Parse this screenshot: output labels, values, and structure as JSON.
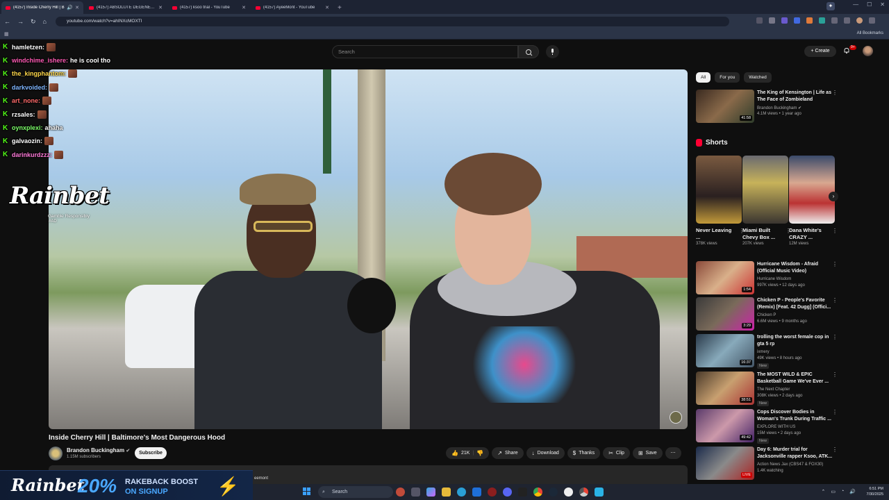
{
  "browser": {
    "tabs": [
      {
        "title": "(4157) Inside Cherry Hill | B",
        "active": true
      },
      {
        "title": "(4157) ABSOLUTE DEGENERATE",
        "active": false
      },
      {
        "title": "(4157) ksoo trial - YouTube",
        "active": false
      },
      {
        "title": "(4157) AyeeMont - YouTube",
        "active": false
      }
    ],
    "url": "youtube.com/watch?v=ahINXcMOXTI",
    "all_bookmarks": "All Bookmarks"
  },
  "header": {
    "search_placeholder": "Search",
    "create_label": "Create",
    "notif_badge": "9+"
  },
  "chat": [
    {
      "user": "hamletzen:",
      "color": "#ffffff",
      "msg": "",
      "emote": true
    },
    {
      "user": "windchime_ishere:",
      "color": "#ff5ab4",
      "msg": "he is cool tho",
      "emote": false
    },
    {
      "user": "the_kingphantom:",
      "color": "#ffd84a",
      "msg": "",
      "emote": true
    },
    {
      "user": "darkvoided:",
      "color": "#7fb6ff",
      "msg": "",
      "emote": true
    },
    {
      "user": "art_none:",
      "color": "#ff6a6a",
      "msg": "",
      "emote": true
    },
    {
      "user": "rzsales:",
      "color": "#ffffff",
      "msg": "",
      "emote": true
    },
    {
      "user": "oynxplexi:",
      "color": "#7dff6a",
      "msg": "ahaha",
      "emote": false
    },
    {
      "user": "galvaozin:",
      "color": "#ffffff",
      "msg": "",
      "emote": true
    },
    {
      "user": "darinkurdzzz:",
      "color": "#ff7ad9",
      "msg": "",
      "emote": true
    }
  ],
  "overlay": {
    "rainbet_logo": "Rainbet",
    "gamble_responsibly": "Gamble Responsibly",
    "ad_tag": "#AD",
    "banner_brand": "Rainbet",
    "banner_pct": "20%",
    "banner_line1": "RAKEBACK BOOST",
    "banner_line2": "ON SIGNUP"
  },
  "video": {
    "title": "Inside Cherry Hill | Baltimore's Most Dangerous Hood",
    "channel": "Brandon Buckingham",
    "subscribers": "1.15M subscribers",
    "subscribe_label": "Subscribe",
    "likes": "21K",
    "share_label": "Share",
    "download_label": "Download",
    "thanks_label": "Thanks",
    "clip_label": "Clip",
    "save_label": "Save",
    "desc_fragment": "eemont"
  },
  "filters": [
    "All",
    "For you",
    "Watched"
  ],
  "shorts_heading": "Shorts",
  "top_rec": {
    "title": "The King of Kensington | Life as The Face of Zombieland",
    "channel": "Brandon Buckingham",
    "meta": "4.1M views • 1 year ago",
    "duration": "41:58"
  },
  "shorts": [
    {
      "title": "Never Leaving ...",
      "views": "378K views"
    },
    {
      "title": "Miami Built Chevy Box ...",
      "views": "207K views"
    },
    {
      "title": "Dana White's CRAZY ...",
      "views": "12M views"
    }
  ],
  "recs": [
    {
      "title": "Hurricane Wisdom - Afraid (Official Music Video)",
      "channel": "Hurricane Wisdom",
      "meta": "997K views • 12 days ago",
      "duration": "1:54",
      "new": ""
    },
    {
      "title": "Chicken P - People's Favorite (Remix) [Feat. 42 Dugg] (Offici...",
      "channel": "Chicken P",
      "meta": "6.6M views • 9 months ago",
      "duration": "3:29",
      "new": ""
    },
    {
      "title": "trolling the worst female cop in gta 5 rp",
      "channel": "ixmery",
      "meta": "49K views • 8 hours ago",
      "duration": "16:37",
      "new": "New"
    },
    {
      "title": "The MOST WILD & EPIC Basketball Game We've Ever ...",
      "channel": "The Next Chapter",
      "meta": "308K views • 2 days ago",
      "duration": "38:51",
      "new": "New"
    },
    {
      "title": "Cops Discover Bodies in Woman's Trunk During Traffic ...",
      "channel": "EXPLORE WITH US",
      "meta": "15M views • 2 days ago",
      "duration": "49:42",
      "new": "New"
    },
    {
      "title": "Day 6: Murder trial for Jacksonville rapper Ksoo, ATK...",
      "channel": "Action News Jax (CBS47 & FOX30)",
      "meta": "1.4K watching",
      "duration": "LIVE",
      "new": ""
    }
  ],
  "taskbar": {
    "search_label": "Search",
    "time": "6:51 PM",
    "date": "7/30/2025"
  }
}
